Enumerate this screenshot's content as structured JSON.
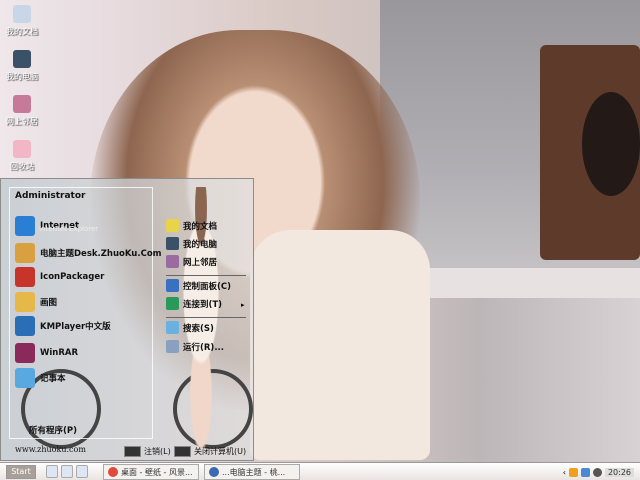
{
  "desktop_icons": [
    {
      "label": "我的文档",
      "icon": "my-documents-icon",
      "color": "#c8d6e8"
    },
    {
      "label": "我的电脑",
      "icon": "my-computer-icon",
      "color": "#3b5168"
    },
    {
      "label": "网上邻居",
      "icon": "network-icon",
      "color": "#c47a98"
    },
    {
      "label": "回收站",
      "icon": "recycle-bin-icon",
      "color": "#f2b6c6"
    }
  ],
  "start_menu": {
    "user": "Administrator",
    "left_items": [
      {
        "label": "Internet",
        "sub": "Internet Explorer",
        "icon": "internet-explorer-icon",
        "color": "#2a7fd4"
      },
      {
        "label": "电脑主题Desk.ZhuoKu.Com",
        "icon": "theme-icon",
        "color": "#d8a040"
      },
      {
        "label": "IconPackager",
        "icon": "iconpackager-icon",
        "color": "#c7352a"
      },
      {
        "label": "画图",
        "icon": "paint-icon",
        "color": "#e6b84a"
      },
      {
        "label": "KMPlayer中文版",
        "icon": "kmplayer-icon",
        "color": "#2a6fb5"
      },
      {
        "label": "WinRAR",
        "icon": "winrar-icon",
        "color": "#8a2a5a"
      },
      {
        "label": "记事本",
        "icon": "notepad-icon",
        "color": "#5aa8e0"
      }
    ],
    "all_programs": "所有程序(P)",
    "website": "www.zhuoku.com",
    "right_items": [
      {
        "label": "我的文档",
        "icon": "my-documents-icon",
        "color": "#e8d34a"
      },
      {
        "label": "我的电脑",
        "icon": "my-computer-icon",
        "color": "#3b5168"
      },
      {
        "label": "网上邻居",
        "icon": "network-icon",
        "color": "#9a6aa0"
      },
      {
        "label": "控制面板(C)",
        "icon": "control-panel-icon",
        "color": "#3a70c0"
      },
      {
        "label": "连接到(T)",
        "icon": "connect-icon",
        "color": "#2a9a5a"
      },
      {
        "label": "搜索(S)",
        "icon": "search-icon",
        "color": "#6ab0e0"
      },
      {
        "label": "运行(R)...",
        "icon": "run-icon",
        "color": "#8aa0c0"
      }
    ],
    "logoff": "注销(L)",
    "shutdown": "关闭计算机(U)"
  },
  "taskbar": {
    "start": "Start",
    "quick_launch": [
      {
        "icon": "ie-icon"
      },
      {
        "icon": "media-icon"
      },
      {
        "icon": "show-desktop-icon"
      }
    ],
    "tasks": [
      {
        "label": "桌面 - 壁纸 - 风景...",
        "icon": "chrome-icon",
        "color": "#e04a3a"
      },
      {
        "label": "...电脑主题 - 桃...",
        "icon": "document-icon",
        "color": "#3a6ab0"
      }
    ],
    "tray_icons": [
      {
        "icon": "qq-icon",
        "color": "#f0a020"
      },
      {
        "icon": "network-tray-icon",
        "color": "#4a8ad0"
      },
      {
        "icon": "security-icon",
        "color": "#555"
      }
    ],
    "time": "20:26"
  }
}
